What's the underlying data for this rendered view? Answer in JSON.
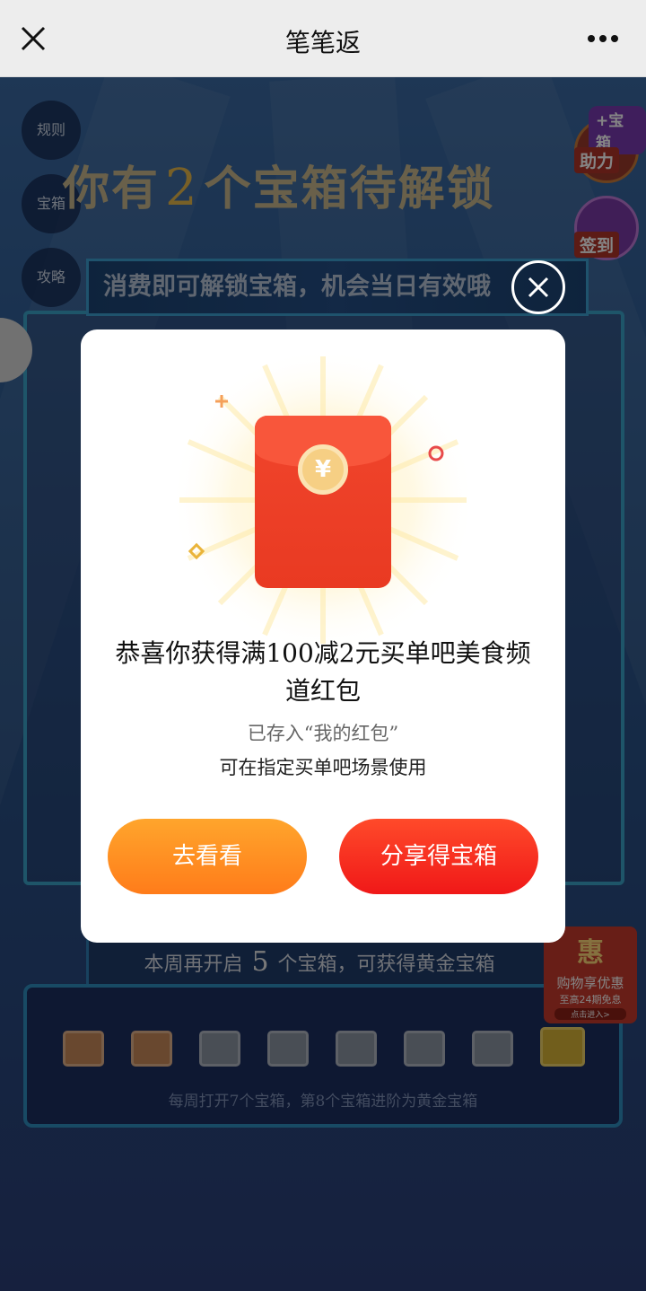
{
  "nav": {
    "title": "笔笔返"
  },
  "side": {
    "rules": "规则",
    "chest": "宝箱",
    "guide": "攻略"
  },
  "headline": {
    "pre": "你有",
    "count": "2",
    "post": "个宝箱待解锁"
  },
  "banner": {
    "text": "消费即可解锁宝箱，机会当日有效哦"
  },
  "promo": {
    "help_tag": "+宝箱",
    "help_label": "助力",
    "signin_label": "签到"
  },
  "week": {
    "pre": "本周再开启",
    "count": "5",
    "post": "个宝箱，可获得黄金宝箱"
  },
  "chest_note": "每周打开7个宝箱，第8个宝箱进阶为黄金宝箱",
  "shop": {
    "title": "惠",
    "line1": "购物享优惠",
    "line2": "至高24期免息",
    "line3": "点击进入>"
  },
  "dialog": {
    "title": "恭喜你获得满100减2元买单吧美食频道红包",
    "sub1": "已存入“我的红包”",
    "sub2": "可在指定买单吧场景使用",
    "btn_look": "去看看",
    "btn_share": "分享得宝箱"
  },
  "colors": {
    "accent_orange": "#ff8c1f",
    "accent_red": "#f02a1e",
    "envelope_red": "#ea3c24"
  }
}
